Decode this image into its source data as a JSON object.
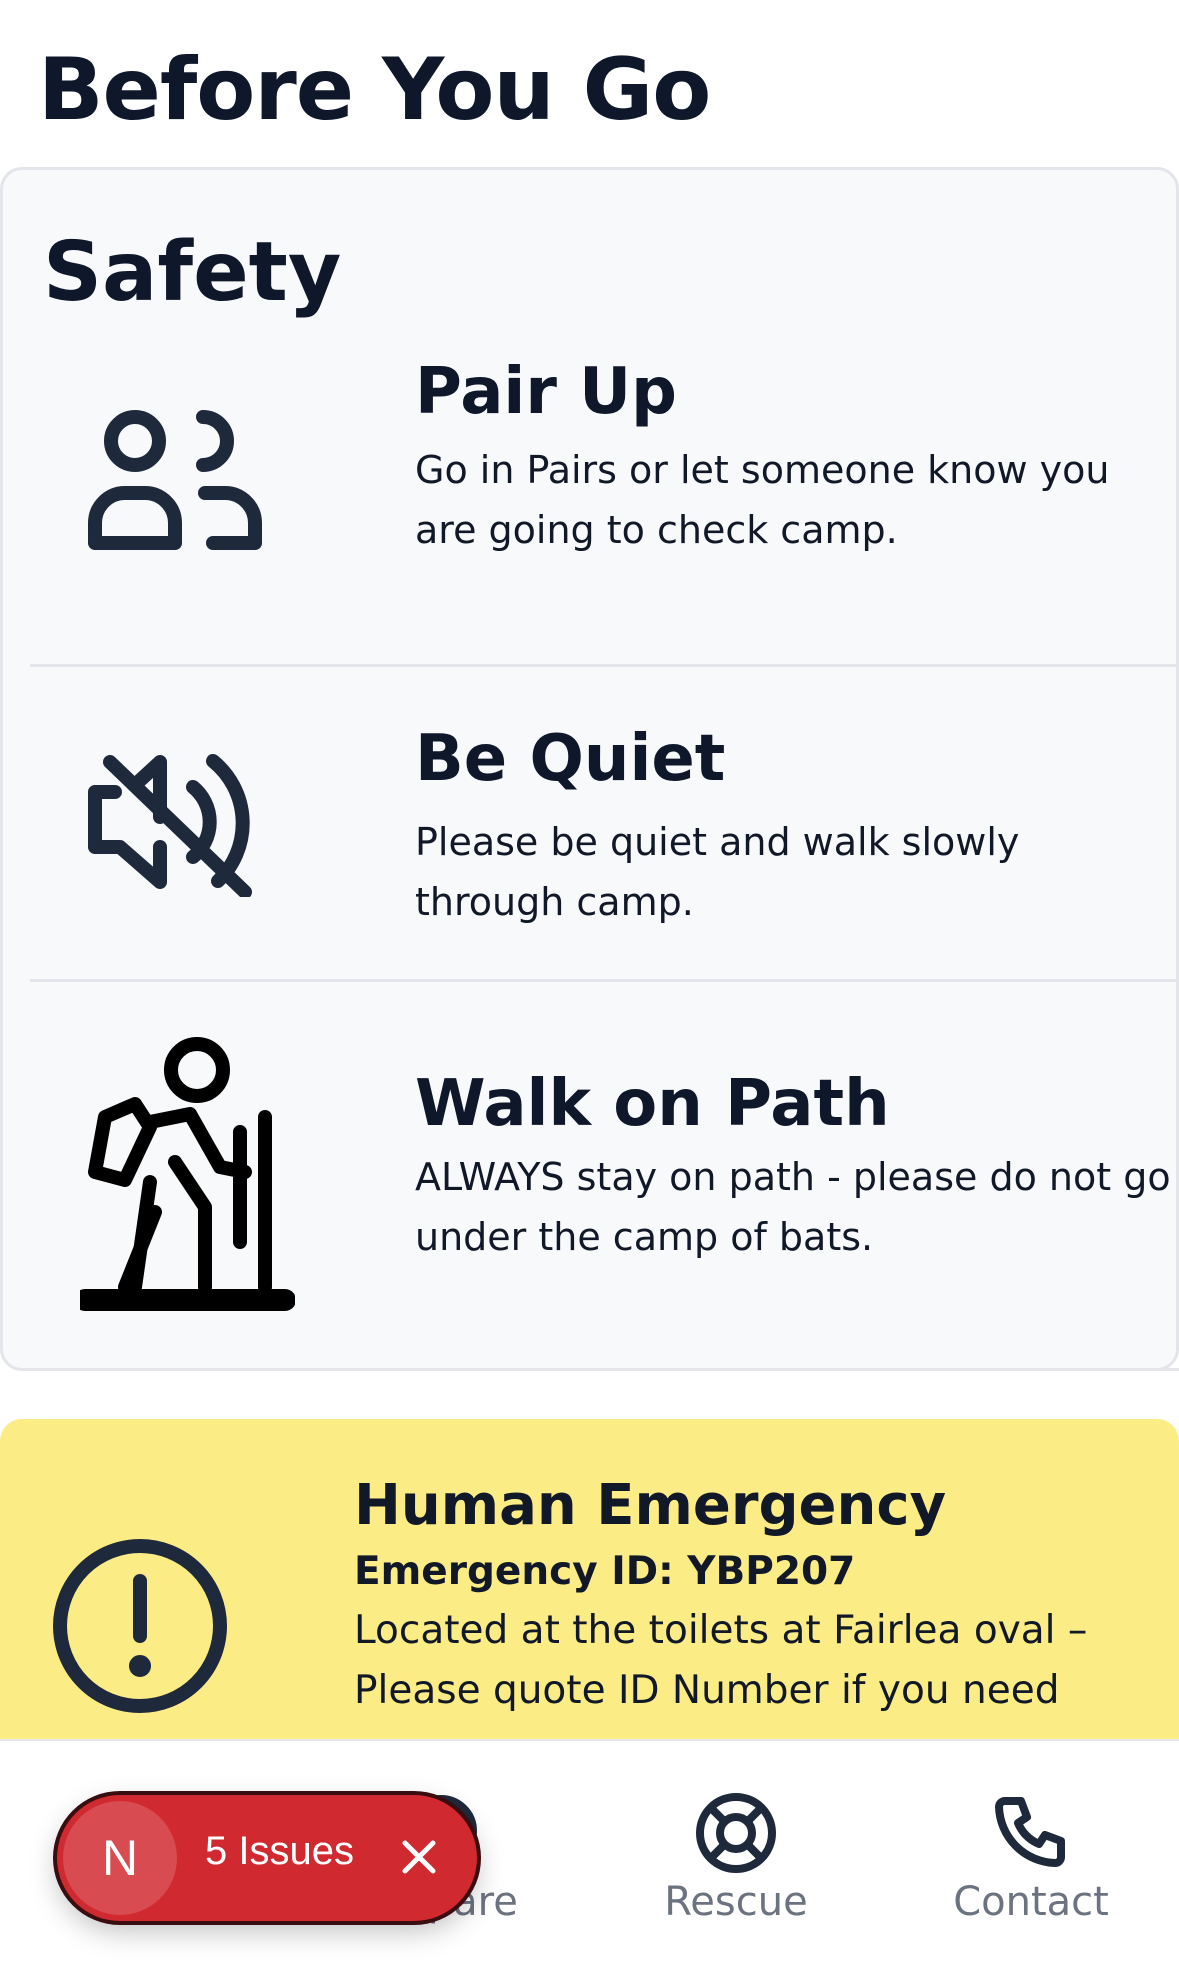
{
  "page": {
    "title": "Before You Go"
  },
  "safety": {
    "title": "Safety",
    "tips": [
      {
        "title": "Pair Up",
        "description": "Go in Pairs or let someone know you are going to check camp.",
        "icon": "users-icon"
      },
      {
        "title": "Be Quiet",
        "description": "Please be quiet and walk slowly through camp.",
        "icon": "volume-off-icon"
      },
      {
        "title": "Walk on Path",
        "description": "ALWAYS stay on path - please do not go under the camp of bats.",
        "icon": "hiker-icon"
      }
    ]
  },
  "emergency": {
    "title": "Human Emergency",
    "id_line": "Emergency ID: YBP207",
    "description": "Located at the toilets at Fairlea oval – Please quote ID Number if you need",
    "icon": "alert-circle-icon",
    "background": "#fcec86"
  },
  "bottom_nav": {
    "items": [
      {
        "label": "",
        "icon": "home-icon"
      },
      {
        "label": "Prepare",
        "icon": "compass-icon"
      },
      {
        "label": "Rescue",
        "icon": "lifebuoy-icon"
      },
      {
        "label": "Contact",
        "icon": "phone-icon"
      }
    ]
  },
  "issues_overlay": {
    "badge": "N",
    "label": "5 Issues",
    "color": "#d0292f"
  }
}
